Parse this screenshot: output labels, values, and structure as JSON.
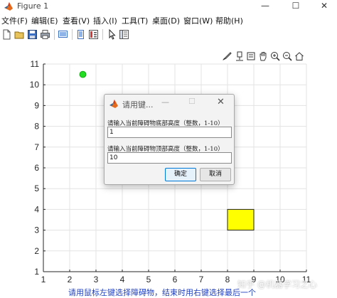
{
  "window": {
    "title": "Figure 1",
    "minimize": "—",
    "maximize": "☐",
    "close": "✕"
  },
  "menu": [
    {
      "label": "文件(F)"
    },
    {
      "label": "编辑(E)"
    },
    {
      "label": "查看(V)"
    },
    {
      "label": "插入(I)"
    },
    {
      "label": "工具(T)"
    },
    {
      "label": "桌面(D)"
    },
    {
      "label": "窗口(W)"
    },
    {
      "label": "帮助(H)"
    }
  ],
  "toolbar_icons": [
    "new-file-icon",
    "open-folder-icon",
    "save-icon",
    "print-icon",
    "link-figure-icon",
    "dock-icon",
    "insert-colorbar-icon",
    "pointer-icon",
    "property-inspector-icon"
  ],
  "axes_toolbar_icons": [
    "brush-icon",
    "data-tips-icon",
    "rotate-icon",
    "pan-icon",
    "zoom-in-icon",
    "zoom-out-icon",
    "home-icon"
  ],
  "chart_data": {
    "type": "scatter",
    "xlim": [
      1,
      11
    ],
    "ylim": [
      1,
      11
    ],
    "xticks": [
      1,
      2,
      3,
      4,
      5,
      6,
      7,
      8,
      9,
      10,
      11
    ],
    "yticks": [
      1,
      2,
      3,
      4,
      5,
      6,
      7,
      8,
      9,
      10,
      11
    ],
    "grid": true,
    "points": [
      {
        "x": 2.5,
        "y": 10.5,
        "color": "#22dd22"
      }
    ],
    "rectangles": [
      {
        "x0": 8,
        "y0": 3,
        "x1": 9,
        "y1": 4,
        "color": "#ffff00"
      }
    ]
  },
  "dialog": {
    "title": "请用键...",
    "min": "—",
    "max": "☐",
    "close": "✕",
    "prompt1": "请输入当前障碍物底部高度（整数，1-10）",
    "value1": "1",
    "prompt2": "请输入当前障碍物顶部高度（整数，1-10）",
    "value2": "10",
    "ok": "确定",
    "cancel": "取消"
  },
  "status_text": "请用鼠标左键选择障碍物，结束时用右键选择最后一个",
  "watermark": "知乎 @机器学习之心"
}
